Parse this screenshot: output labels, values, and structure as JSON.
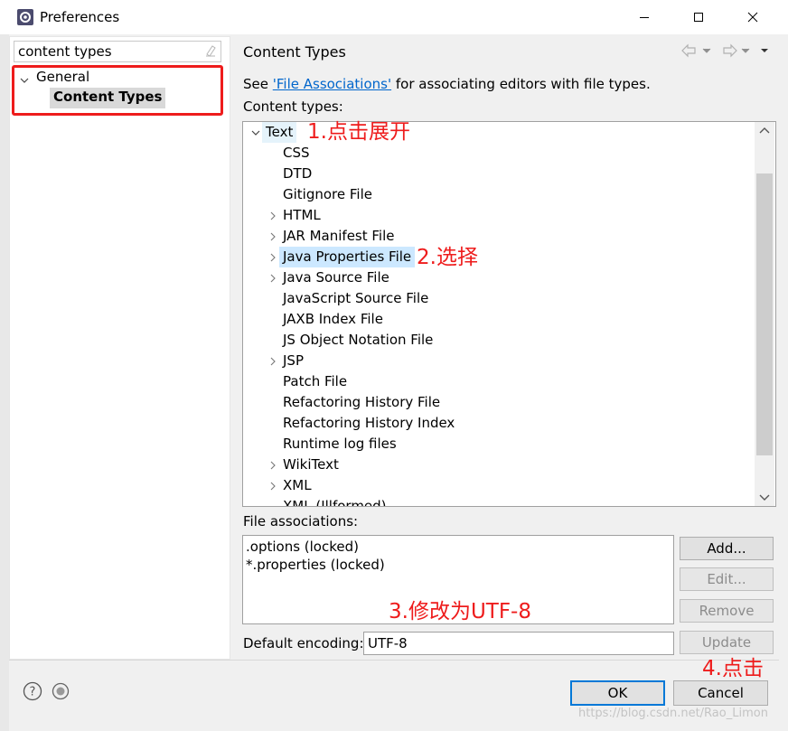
{
  "window": {
    "title": "Preferences"
  },
  "left": {
    "filter_value": "content types",
    "tree": {
      "general": "General",
      "content_types": "Content Types"
    }
  },
  "right": {
    "page_title": "Content Types",
    "desc_prefix": "See ",
    "desc_link": "'File Associations'",
    "desc_suffix": " for associating editors with file types.",
    "content_types_label": "Content types:",
    "content_types": [
      {
        "label": "Text",
        "expandable": true,
        "expanded": true
      },
      {
        "label": "CSS",
        "expandable": false
      },
      {
        "label": "DTD",
        "expandable": false
      },
      {
        "label": "Gitignore File",
        "expandable": false
      },
      {
        "label": "HTML",
        "expandable": true
      },
      {
        "label": "JAR Manifest File",
        "expandable": true
      },
      {
        "label": "Java Properties File",
        "expandable": true,
        "selected": true
      },
      {
        "label": "Java Source File",
        "expandable": true
      },
      {
        "label": "JavaScript Source File",
        "expandable": false
      },
      {
        "label": "JAXB Index File",
        "expandable": false
      },
      {
        "label": "JS Object Notation File",
        "expandable": false
      },
      {
        "label": "JSP",
        "expandable": true
      },
      {
        "label": "Patch File",
        "expandable": false
      },
      {
        "label": "Refactoring History File",
        "expandable": false
      },
      {
        "label": "Refactoring History Index",
        "expandable": false
      },
      {
        "label": "Runtime log files",
        "expandable": false
      },
      {
        "label": "WikiText",
        "expandable": true
      },
      {
        "label": "XML",
        "expandable": true
      },
      {
        "label": "XML (Illformed)",
        "expandable": false
      }
    ],
    "file_associations_label": "File associations:",
    "file_associations": [
      ".options (locked)",
      "*.properties (locked)"
    ],
    "buttons": {
      "add": "Add...",
      "edit": "Edit...",
      "remove": "Remove",
      "update": "Update"
    },
    "encoding_label": "Default encoding:",
    "encoding_value": "UTF-8"
  },
  "dialog_buttons": {
    "ok": "OK",
    "cancel": "Cancel"
  },
  "annotations": {
    "step1": "1.点击展开",
    "step2": "2.选择",
    "step3": "3.修改为UTF-8",
    "step4": "4.点击"
  },
  "watermark": "https://blog.csdn.net/Rao_Limon",
  "colors": {
    "annotation_red": "#ee1c1c",
    "link_blue": "#0066cc",
    "selection_blue": "#cce8ff",
    "ok_border": "#0078d7"
  }
}
